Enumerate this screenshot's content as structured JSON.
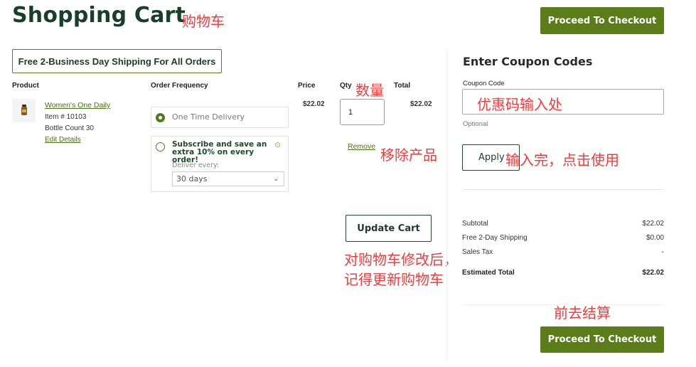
{
  "header": {
    "title": "Shopping Cart",
    "title_annotation": "购物车",
    "checkout_label": "Proceed To Checkout"
  },
  "banner": {
    "text": "Free 2-Business Day Shipping For All Orders"
  },
  "cart": {
    "columns": {
      "product": "Product",
      "frequency": "Order Frequency",
      "price": "Price",
      "qty": "Qty",
      "total": "Total"
    },
    "qty_annotation": "数量",
    "items": [
      {
        "name": "Women's One Daily",
        "item_number": "Item # 10103",
        "bottle_count": "Bottle Count 30",
        "edit_label": "Edit Details",
        "price": "$22.02",
        "qty": "1",
        "total": "$22.02",
        "remove_label": "Remove",
        "remove_annotation": "移除产品",
        "frequency": {
          "one_time_label": "One Time Delivery",
          "one_time_selected": true,
          "subscribe_label": "Subscribe and save an extra 10% on every order!",
          "subscribe_selected": false,
          "deliver_every_label": "Deliver every:",
          "deliver_every_value": "30 days"
        }
      }
    ],
    "update_label": "Update Cart",
    "update_annotation_line1": "对购物车修改后，",
    "update_annotation_line2": "记得更新购物车"
  },
  "coupon": {
    "heading": "Enter Coupon Codes",
    "field_label": "Coupon Code",
    "field_value": "",
    "field_annotation": "优惠码输入处",
    "optional_label": "Optional",
    "apply_label": "Apply",
    "apply_annotation": "输入完，点击使用"
  },
  "summary": {
    "rows": [
      {
        "label": "Subtotal",
        "value": "$22.02"
      },
      {
        "label": "Free 2-Day Shipping",
        "value": "$0.00"
      },
      {
        "label": "Sales Tax",
        "value": "-"
      }
    ],
    "estimated_total_label": "Estimated Total",
    "estimated_total_value": "$22.02",
    "checkout_annotation": "前去结算",
    "checkout_label": "Proceed To Checkout"
  },
  "colors": {
    "brand_green": "#5a7d1a",
    "title_green": "#173f2c",
    "annotation_red": "#f03c3c"
  }
}
